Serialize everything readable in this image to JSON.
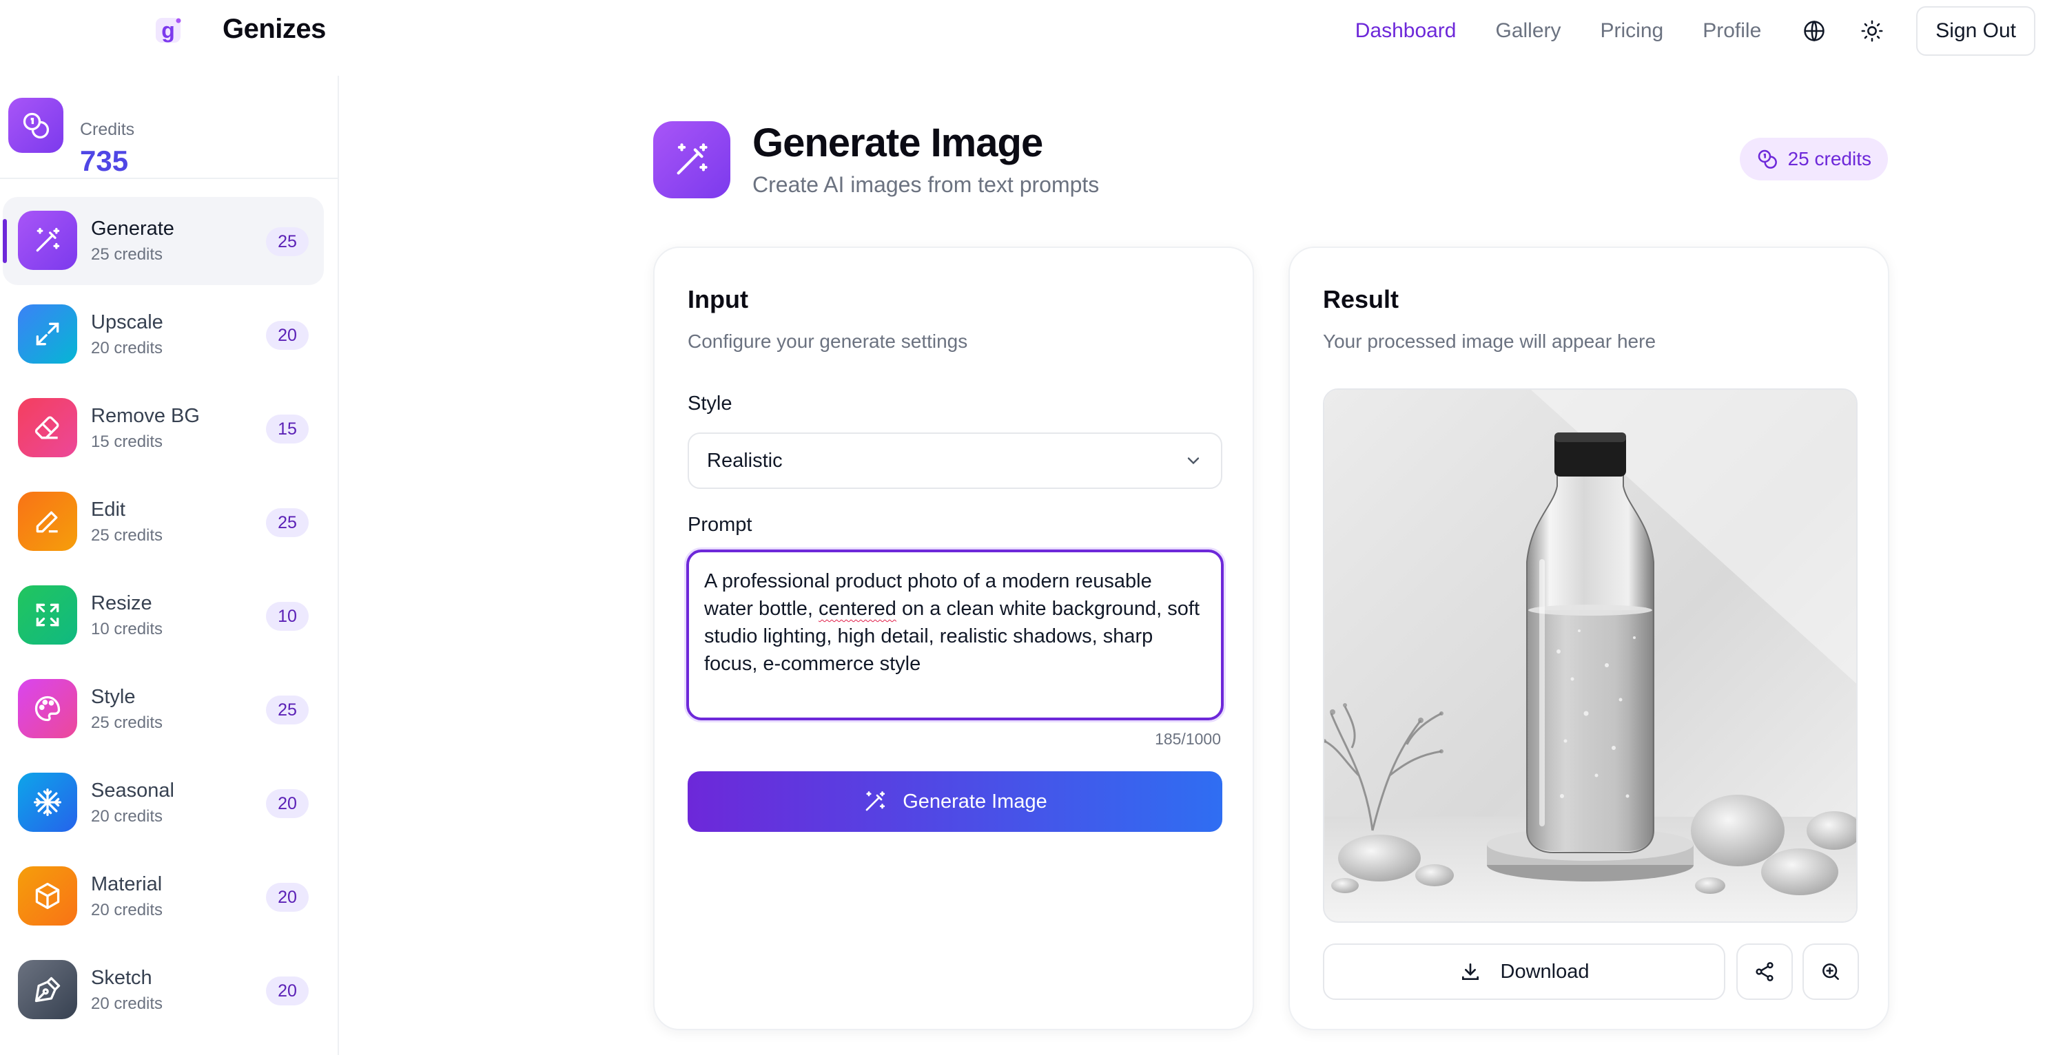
{
  "brand": {
    "name": "Genizes",
    "logo_icon": "g-logo-icon",
    "accent": "#7c3aed"
  },
  "nav": {
    "links": [
      {
        "label": "Dashboard",
        "active": true
      },
      {
        "label": "Gallery",
        "active": false
      },
      {
        "label": "Pricing",
        "active": false
      },
      {
        "label": "Profile",
        "active": false
      }
    ],
    "language_icon": "globe-icon",
    "theme_icon": "sun-icon",
    "signout_label": "Sign Out"
  },
  "sidebar": {
    "credits_label": "Credits",
    "credits_value": "735",
    "tools": [
      {
        "name": "Generate",
        "cost": "25 credits",
        "badge": "25",
        "icon": "magic-wand-icon",
        "color": "#8b5cf6",
        "active": true
      },
      {
        "name": "Upscale",
        "cost": "20 credits",
        "badge": "20",
        "icon": "expand-arrows-icon",
        "color": "#2563eb"
      },
      {
        "name": "Remove BG",
        "cost": "15 credits",
        "badge": "15",
        "icon": "eraser-icon",
        "color": "#e11d48"
      },
      {
        "name": "Edit",
        "cost": "25 credits",
        "badge": "25",
        "icon": "pencil-icon",
        "color": "#f97316"
      },
      {
        "name": "Resize",
        "cost": "10 credits",
        "badge": "10",
        "icon": "resize-icon",
        "color": "#16a34a"
      },
      {
        "name": "Style",
        "cost": "25 credits",
        "badge": "25",
        "icon": "palette-icon",
        "color": "#d946ef"
      },
      {
        "name": "Seasonal",
        "cost": "20 credits",
        "badge": "20",
        "icon": "snowflake-icon",
        "color": "#2563eb"
      },
      {
        "name": "Material",
        "cost": "20 credits",
        "badge": "20",
        "icon": "cube-icon",
        "color": "#f97316"
      },
      {
        "name": "Sketch",
        "cost": "20 credits",
        "badge": "20",
        "icon": "pen-nib-icon",
        "color": "#4b5563"
      }
    ]
  },
  "header": {
    "title": "Generate Image",
    "subtitle": "Create AI images from text prompts",
    "credit_chip": "25 credits"
  },
  "input_card": {
    "title": "Input",
    "subtitle": "Configure your generate settings",
    "style_label": "Style",
    "style_value": "Realistic",
    "prompt_label": "Prompt",
    "prompt_pre": "A professional product photo of a modern reusable water bottle, ",
    "prompt_flagged": "centered",
    "prompt_post": " on a clean white background, soft studio lighting, high detail, realistic shadows, sharp focus, e-commerce style",
    "char_count": "185/1000",
    "generate_label": "Generate Image"
  },
  "result_card": {
    "title": "Result",
    "subtitle": "Your processed image will appear here",
    "download_label": "Download",
    "share_icon": "share-icon",
    "zoom_icon": "zoom-in-icon"
  }
}
